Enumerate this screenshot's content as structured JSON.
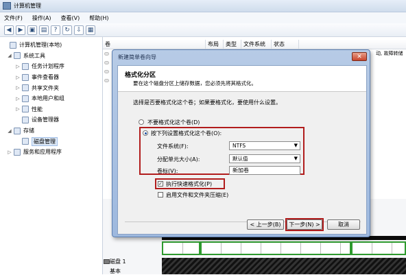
{
  "window": {
    "title": "计算机管理"
  },
  "menu": [
    "文件(F)",
    "操作(A)",
    "查看(V)",
    "帮助(H)"
  ],
  "toolbar_icons": [
    "back-arrow",
    "forward-arrow",
    "up-folder",
    "show-hide-tree",
    "help",
    "refresh",
    "export",
    "properties"
  ],
  "tree": {
    "items": [
      {
        "label": "计算机管理(本地)",
        "exp": "",
        "icon": "computer"
      },
      {
        "label": "系统工具",
        "exp": "◢",
        "icon": "tools"
      },
      {
        "label": "任务计划程序",
        "exp": "▷",
        "icon": "clock"
      },
      {
        "label": "事件查看器",
        "exp": "▷",
        "icon": "event-log"
      },
      {
        "label": "共享文件夹",
        "exp": "▷",
        "icon": "shared-folder"
      },
      {
        "label": "本地用户和组",
        "exp": "▷",
        "icon": "users"
      },
      {
        "label": "性能",
        "exp": "▷",
        "icon": "performance"
      },
      {
        "label": "设备管理器",
        "exp": "",
        "icon": "device"
      },
      {
        "label": "存储",
        "exp": "◢",
        "icon": "storage"
      },
      {
        "label": "磁盘管理",
        "exp": "",
        "icon": "disk"
      },
      {
        "label": "服务和应用程序",
        "exp": "▷",
        "icon": "services"
      }
    ]
  },
  "list": {
    "headers": [
      "卷",
      "布局",
      "类型",
      "文件系统",
      "状态"
    ],
    "right_text": "动, 故障转储"
  },
  "disk": {
    "label": "磁盘 1",
    "sublabel": "基本"
  },
  "wizard": {
    "title": "新建简单卷向导",
    "close": "✕",
    "header_title": "格式化分区",
    "header_sub": "要在这个磁盘分区上储存数据，您必须先将其格式化。",
    "question": "选择是否要格式化这个卷；如果要格式化，要使用什么设置。",
    "opt_no": "不要格式化这个卷(D)",
    "opt_yes": "按下列设置格式化这个卷(O):",
    "fs_label": "文件系统(F):",
    "fs_value": "NTFS",
    "alloc_label": "分配单元大小(A):",
    "alloc_value": "默认值",
    "vol_label": "卷标(V):",
    "vol_value": "新加卷",
    "quick_format": "执行快速格式化(P)",
    "quick_checked": true,
    "compress": "启用文件和文件夹压缩(E)",
    "compress_checked": false,
    "back": "< 上一步(B)",
    "next": "下一步(N) >",
    "cancel": "取消"
  }
}
